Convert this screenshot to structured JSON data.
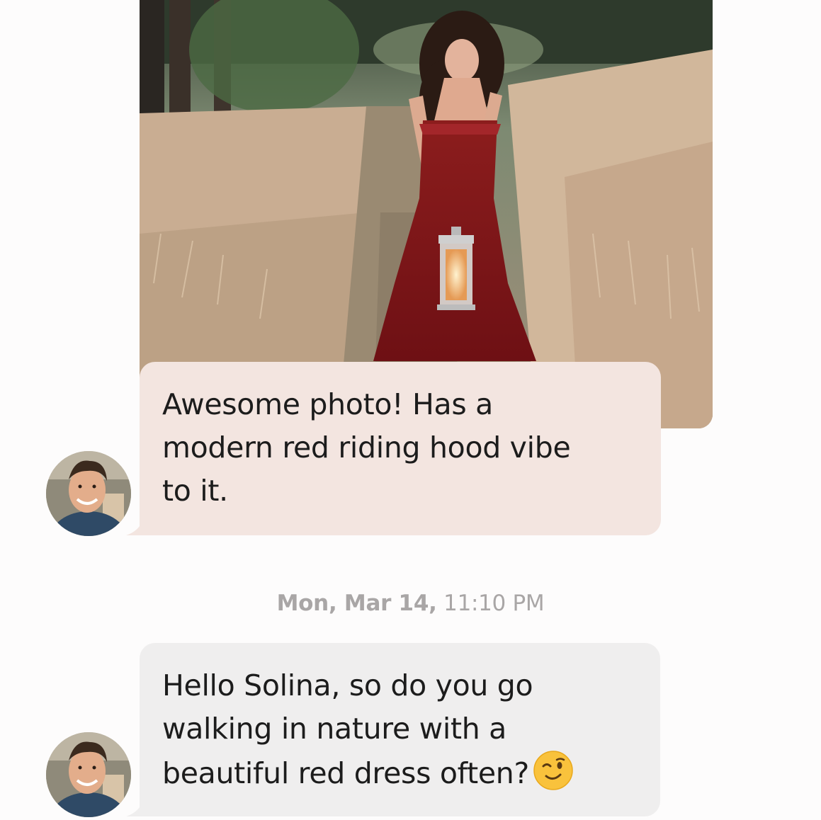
{
  "conversation": {
    "photo": {
      "icon": "shared-photo-woman-red-dress-lantern"
    },
    "messages": [
      {
        "text_line_1": "Awesome photo! Has a",
        "text_line_2": "modern red riding hood vibe",
        "text_line_3": "to it.",
        "bubble_color": "#f3e5e0"
      },
      {
        "text_line_1": "Hello Solina, so do you go",
        "text_line_2": "walking in nature with a",
        "text_line_3": "beautiful red dress often?",
        "emoji": "winking-face-emoji",
        "bubble_color": "#efeeee"
      }
    ],
    "timestamp": {
      "day": "Mon, Mar 14,",
      "time": "11:10 PM"
    },
    "sender_avatar": "avatar-photo"
  }
}
